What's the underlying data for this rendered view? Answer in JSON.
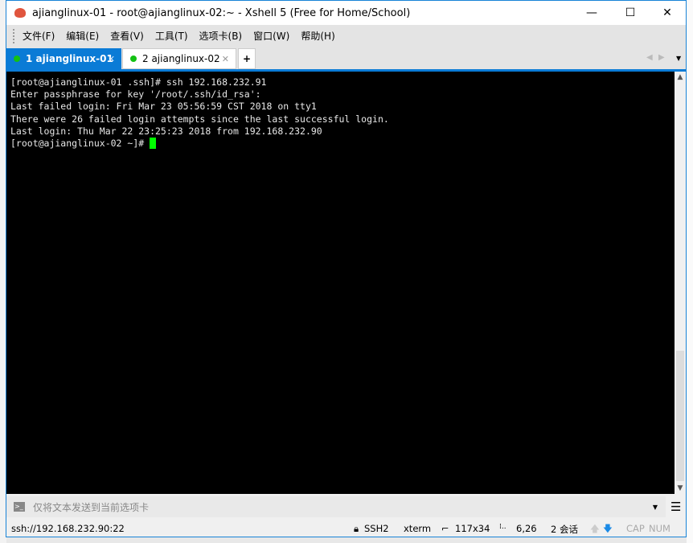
{
  "window": {
    "title": "ajianglinux-01 - root@ajianglinux-02:~ - Xshell 5 (Free for Home/School)"
  },
  "menu": [
    "文件(F)",
    "编辑(E)",
    "查看(V)",
    "工具(T)",
    "选项卡(B)",
    "窗口(W)",
    "帮助(H)"
  ],
  "tabs": [
    {
      "label": "1 ajianglinux-01",
      "active": true
    },
    {
      "label": "2 ajianglinux-02",
      "active": false
    }
  ],
  "terminal": {
    "lines": [
      "[root@ajianglinux-01 .ssh]# ssh 192.168.232.91",
      "Enter passphrase for key '/root/.ssh/id_rsa':",
      "Last failed login: Fri Mar 23 05:56:59 CST 2018 on tty1",
      "There were 26 failed login attempts since the last successful login.",
      "Last login: Thu Mar 22 23:25:23 2018 from 192.168.232.90",
      "[root@ajianglinux-02 ~]# "
    ],
    "cursor_color": "#00ff00"
  },
  "compose": {
    "placeholder": "仅将文本发送到当前选项卡"
  },
  "status": {
    "address": "ssh://192.168.232.90:22",
    "protocol": "SSH2",
    "term": "xterm",
    "size": "117x34",
    "cursor_pos": "6,26",
    "sessions": "2 会话",
    "cap": "CAP",
    "num": "NUM"
  },
  "colors": {
    "accent": "#0a7bd6",
    "connected": "#13c113"
  }
}
